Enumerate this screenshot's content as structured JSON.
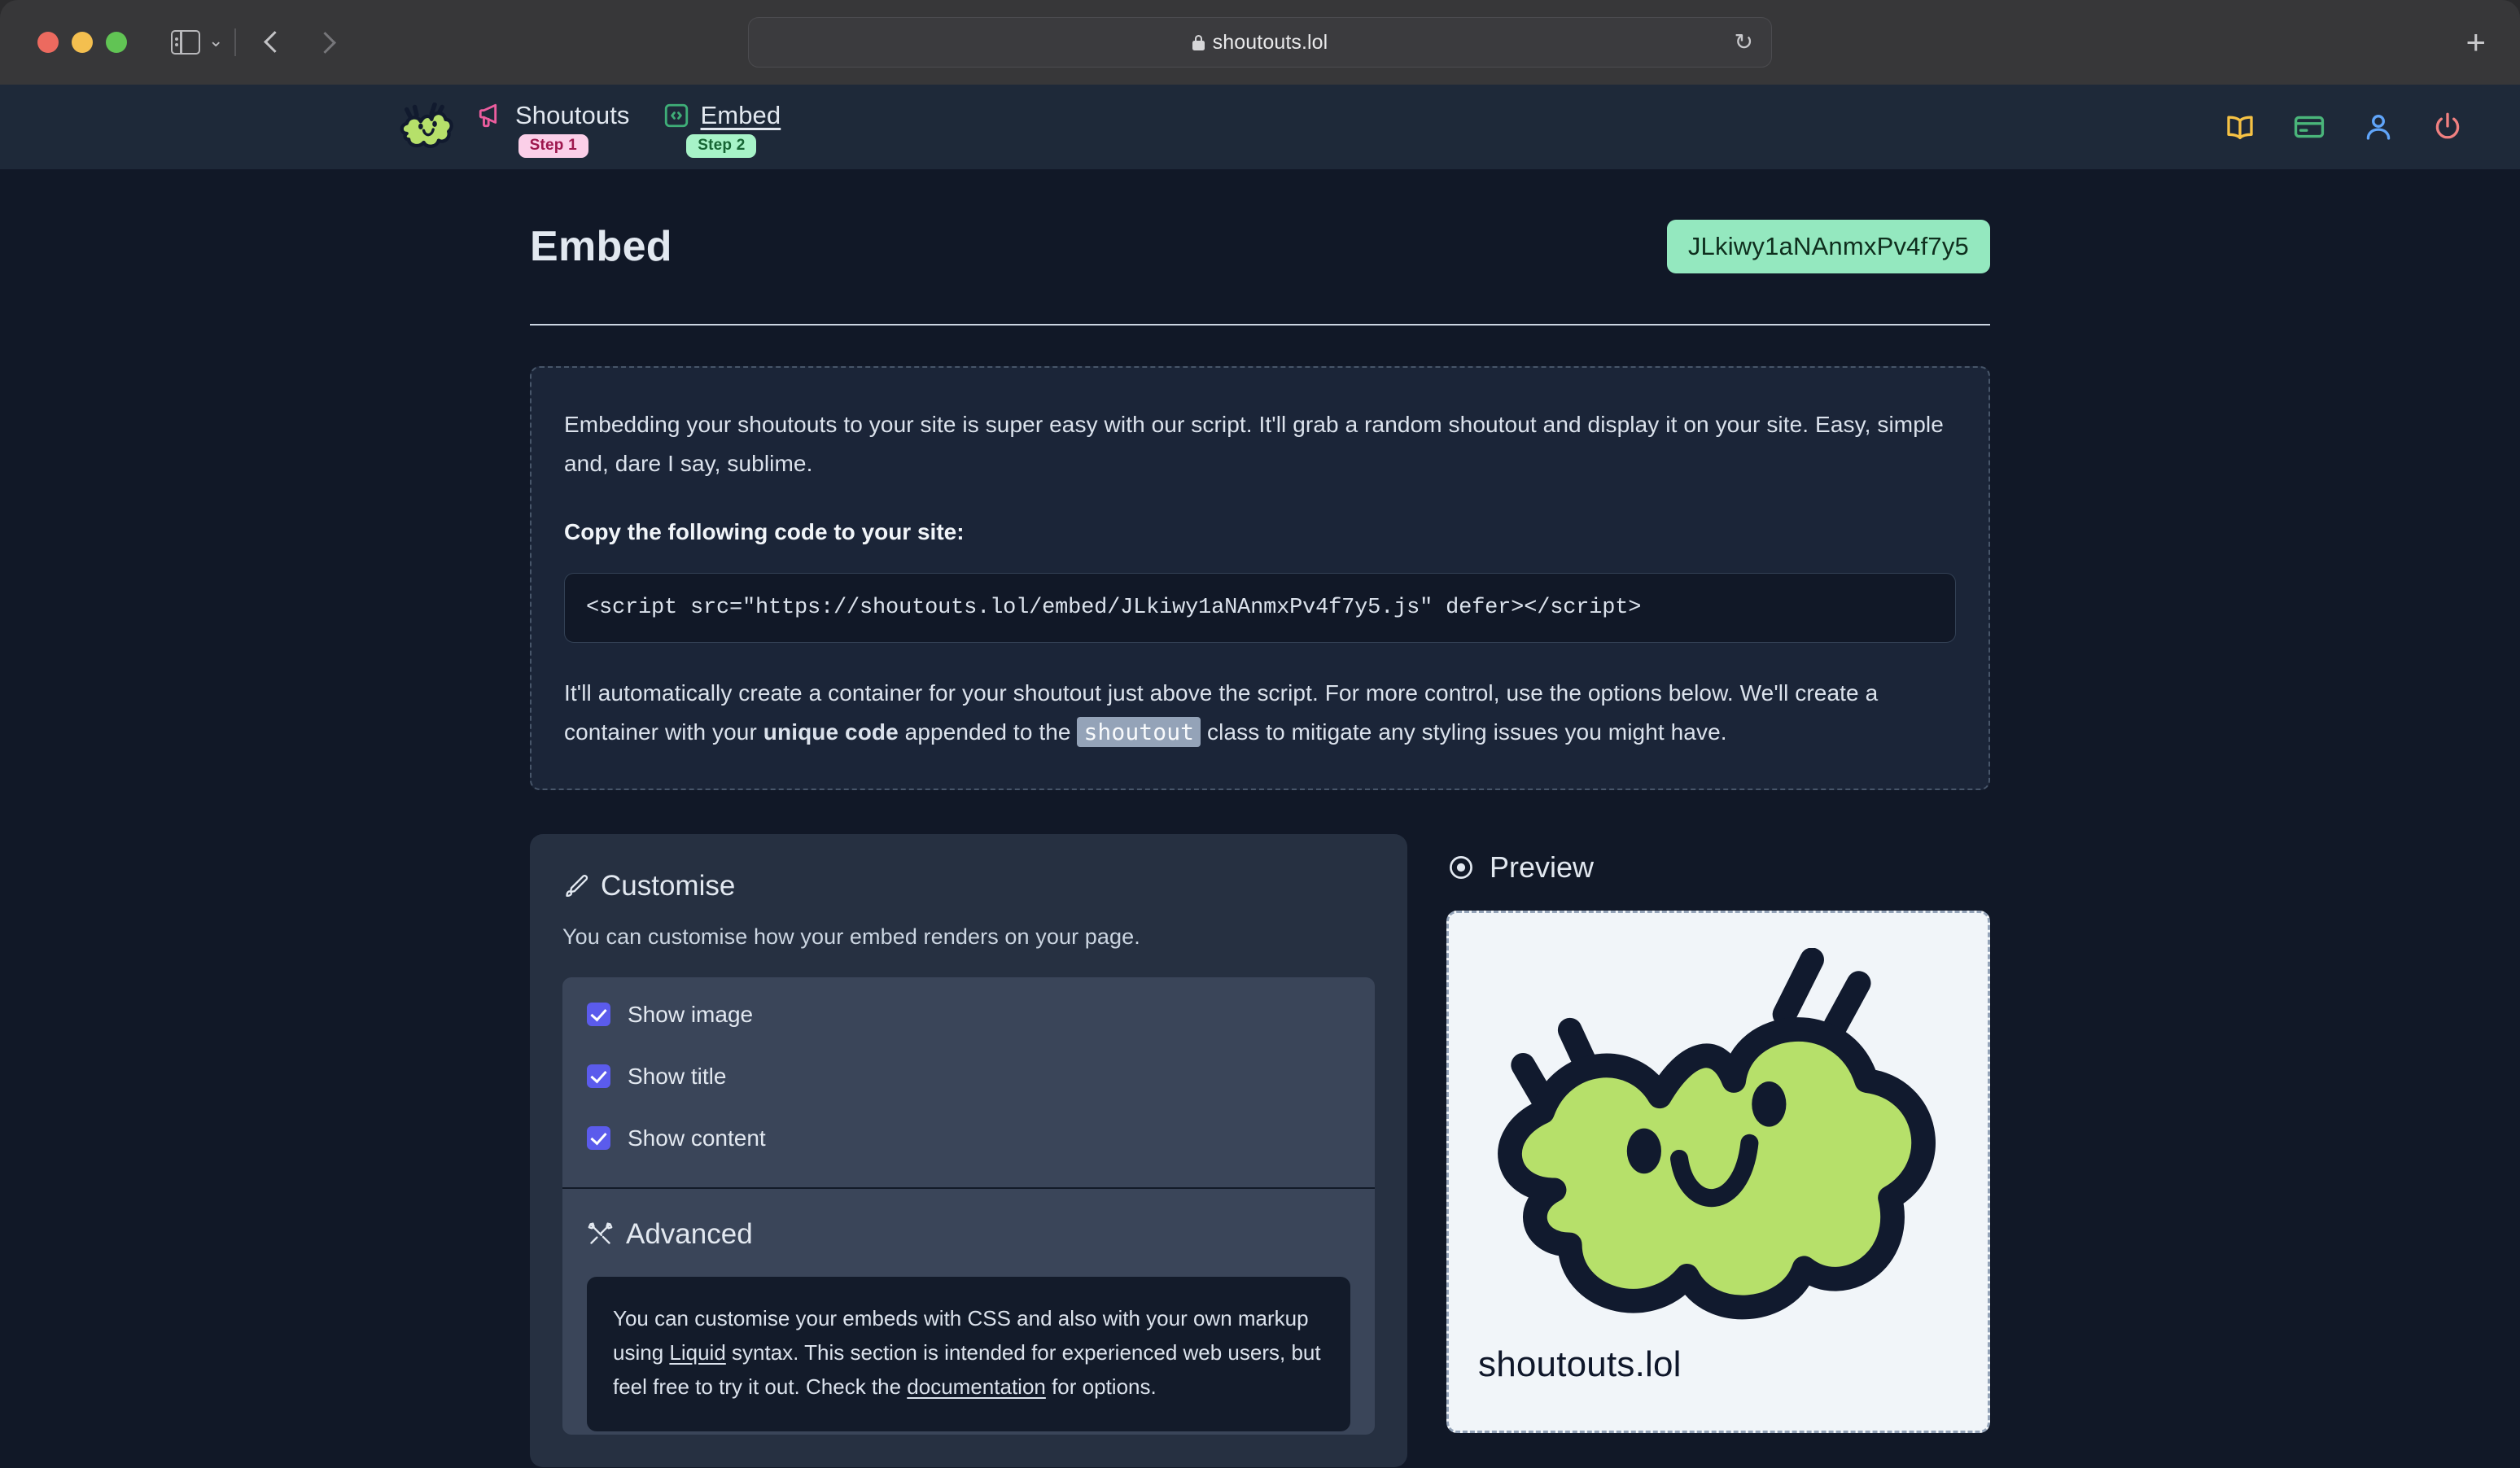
{
  "browser": {
    "url_text": "shoutouts.lol",
    "lock_icon": "lock-icon",
    "reload_glyph": "↻",
    "new_tab_glyph": "+",
    "sidebar_toggle": "sidebar-toggle-icon",
    "back_label": "back-button",
    "forward_label": "forward-button"
  },
  "header": {
    "logo": "shoutouts-mascot-logo",
    "nav": [
      {
        "label": "Shoutouts",
        "step": "Step 1",
        "icon": "megaphone-icon",
        "active": false
      },
      {
        "label": "Embed",
        "step": "Step 2",
        "icon": "code-brackets-icon",
        "active": true
      }
    ],
    "icons": [
      {
        "name": "book-icon",
        "color": "#f6c244"
      },
      {
        "name": "credit-card-icon",
        "color": "#4ab57a"
      },
      {
        "name": "user-icon",
        "color": "#60a5fa"
      },
      {
        "name": "power-icon",
        "color": "#f08080"
      }
    ]
  },
  "main": {
    "title": "Embed",
    "code_badge": "JLkiwy1aNAnmxPv4f7y5",
    "info": {
      "intro": "Embedding your shoutouts to your site is super easy with our script. It'll grab a random shoutout and display it on your site. Easy, simple and, dare I say, sublime.",
      "copy_label": "Copy the following code to your site:",
      "snippet": "<script src=\"https://shoutouts.lol/embed/JLkiwy1aNAnmxPv4f7y5.js\" defer></script>",
      "outro_part1": "It'll automatically create a container for your shoutout just above the script. For more control, use the options below. We'll create a container with your ",
      "outro_bold": "unique code",
      "outro_part2": " appended to the ",
      "outro_code": "shoutout",
      "outro_part3": " class to mitigate any styling issues you might have."
    },
    "customise": {
      "icon": "paintbrush-icon",
      "heading": "Customise",
      "subtitle": "You can customise how your embed renders on your page.",
      "options": [
        {
          "label": "Show image",
          "checked": true
        },
        {
          "label": "Show title",
          "checked": true
        },
        {
          "label": "Show content",
          "checked": true
        }
      ],
      "advanced": {
        "icon": "tools-icon",
        "heading": "Advanced",
        "note_part1": "You can customise your embeds with CSS and also with your own markup using ",
        "note_link1": "Liquid",
        "note_part2": " syntax. This section is intended for experienced web users, but feel free to try it out. Check the ",
        "note_link2": "documentation",
        "note_part3": " for options."
      }
    },
    "preview": {
      "icon": "eye-icon",
      "heading": "Preview",
      "card_title": "shoutouts.lol",
      "card_art": "shoutouts-mascot-illustration"
    }
  },
  "colors": {
    "accent_green": "#94e8bf",
    "accent_pink": "#fbcfe8",
    "checkbox_indigo": "#5b5bec",
    "page_bg": "#111827",
    "header_bg": "#1e2939",
    "mascot_green": "#b6e06a",
    "mascot_outline": "#111a2e"
  }
}
